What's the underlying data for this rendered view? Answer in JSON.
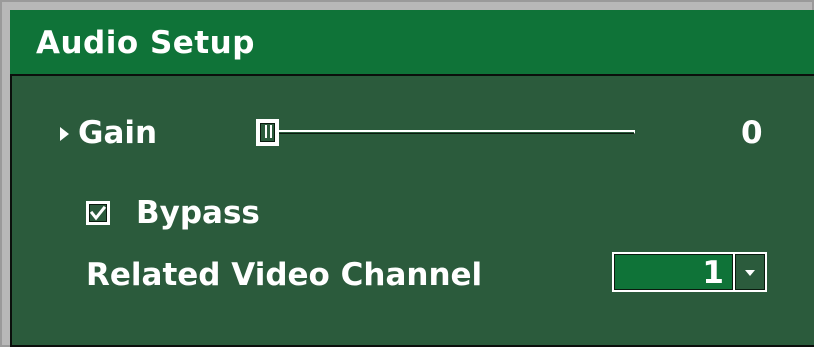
{
  "window": {
    "title": "Audio Setup"
  },
  "gain": {
    "label": "Gain",
    "value": "0",
    "slider_position": 0
  },
  "bypass": {
    "label": "Bypass",
    "checked": true
  },
  "related_video_channel": {
    "label": "Related Video Channel",
    "selected": "1"
  },
  "colors": {
    "title_bar": "#0f7338",
    "panel": "#2b5b3c",
    "text": "#ffffff",
    "frame": "#b8b8b8"
  },
  "icons": {
    "gain_expander": "triangle-right-icon",
    "bypass_check": "check-icon",
    "dropdown": "chevron-down-icon"
  }
}
